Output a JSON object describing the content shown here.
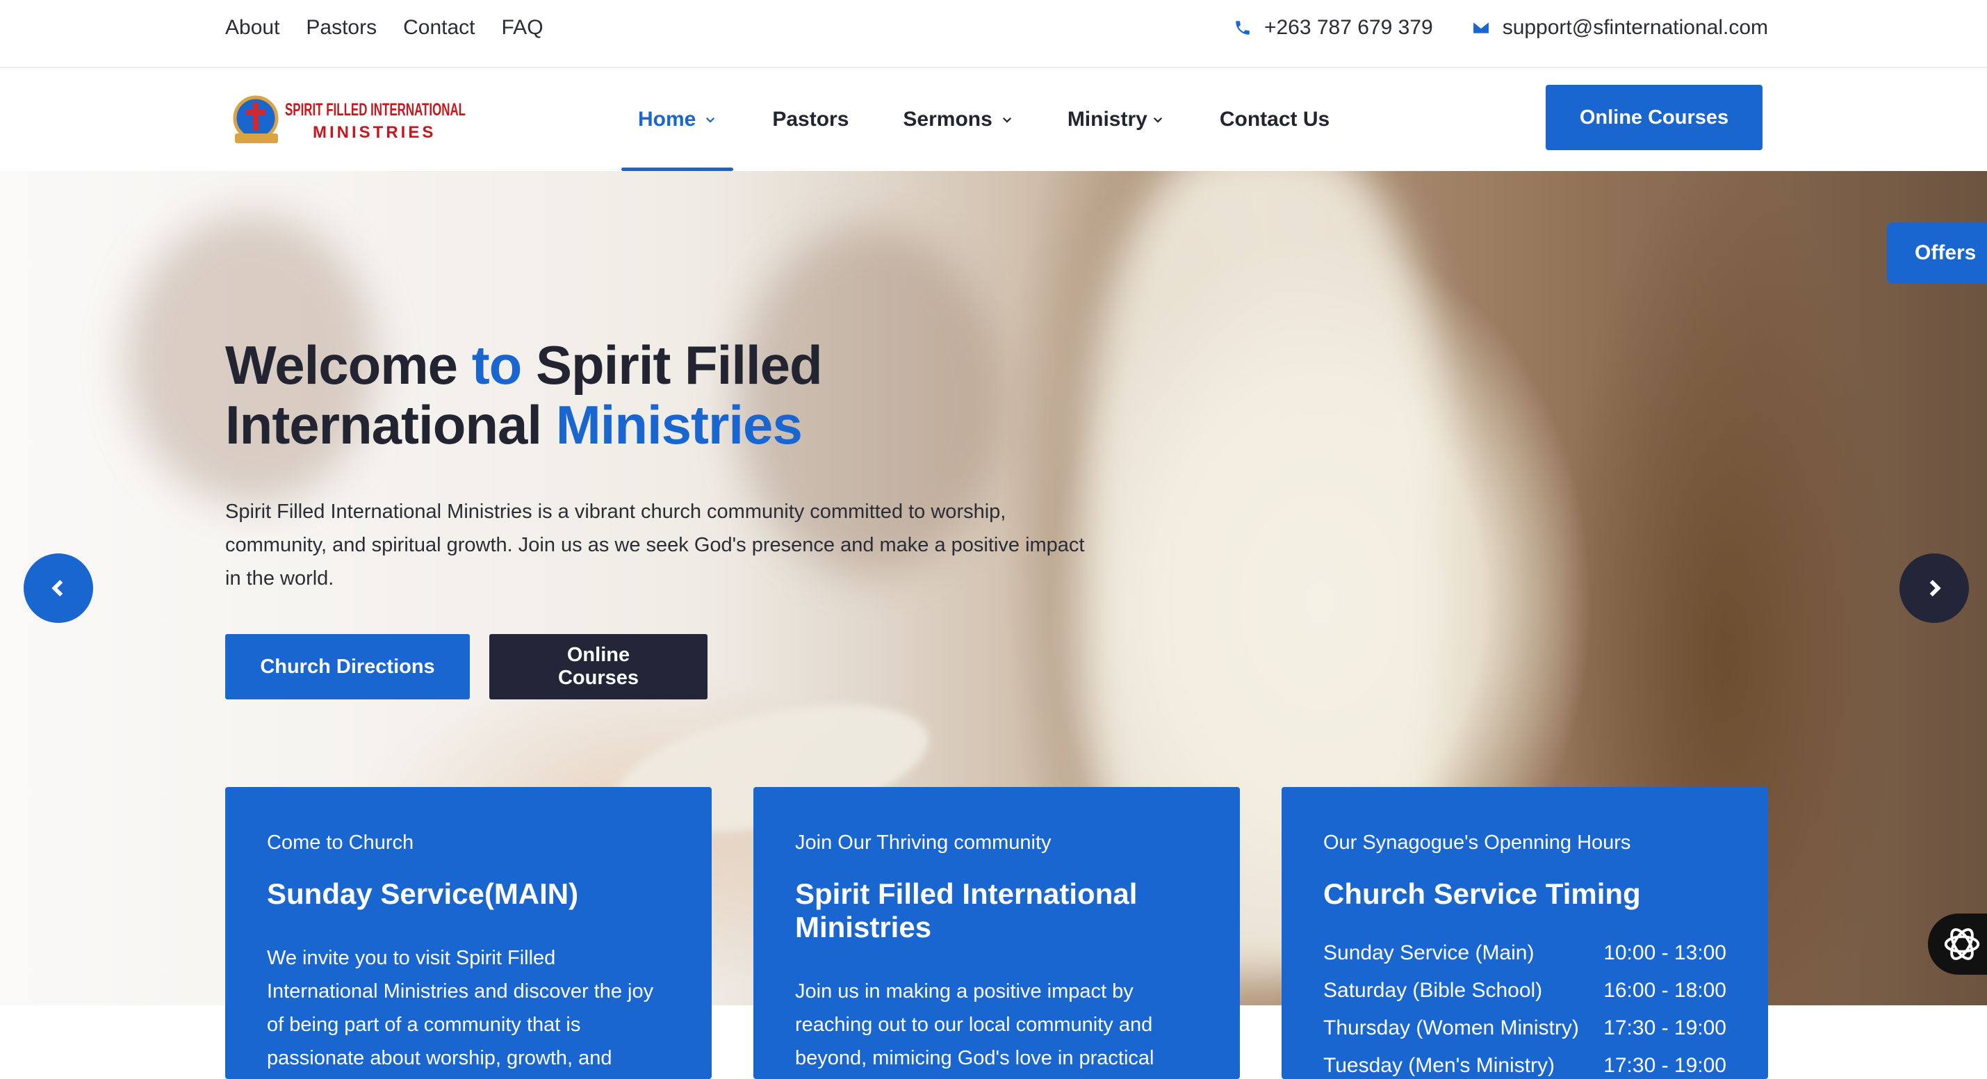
{
  "topbar": {
    "links": [
      "About",
      "Pastors",
      "Contact",
      "FAQ"
    ],
    "phone": "+263 787 679 379",
    "email": "support@sfinternational.com"
  },
  "navbar": {
    "logo": {
      "line1": "SPIRIT FILLED INTERNATIONAL",
      "line2": "MINISTRIES"
    },
    "items": [
      {
        "label": "Home",
        "dropdown": true,
        "active": true
      },
      {
        "label": "Pastors",
        "dropdown": false
      },
      {
        "label": "Sermons",
        "dropdown": true
      },
      {
        "label": "Ministry",
        "dropdown": true
      },
      {
        "label": "Contact Us",
        "dropdown": false
      }
    ],
    "cta": "Online Courses"
  },
  "hero": {
    "title_part1": "Welcome ",
    "title_accent1": "to",
    "title_part2": " Spirit Filled",
    "title_part3": "International ",
    "title_accent2": "Ministries",
    "description": "Spirit Filled International Ministries is a vibrant church community committed to worship, community, and spiritual growth. Join us as we seek God's presence and make a positive impact in the world.",
    "btn_directions": "Church Directions",
    "btn_courses": "Online Courses",
    "offers": "Offers"
  },
  "cards": [
    {
      "kicker": "Come to Church",
      "title": "Sunday Service(MAIN)",
      "body": "We invite you to visit Spirit Filled International Ministries and discover the joy of being part of a community that is passionate about worship, growth, and"
    },
    {
      "kicker": "Join Our Thriving community",
      "title": "Spirit Filled International Ministries",
      "body": "Join us in making a positive impact by reaching out to our local community and beyond, mimicing God's love in practical"
    },
    {
      "kicker": "Our Synagogue's Openning Hours",
      "title": "Church Service Timing",
      "schedule": [
        {
          "name": "Sunday Service (Main)",
          "time": "10:00 - 13:00"
        },
        {
          "name": "Saturday (Bible School)",
          "time": "16:00 - 18:00"
        },
        {
          "name": "Thursday (Women Ministry)",
          "time": "17:30 - 19:00"
        },
        {
          "name": "Tuesday (Men's Ministry)",
          "time": "17:30 - 19:00"
        }
      ]
    }
  ],
  "colors": {
    "accent": "#1a66d0",
    "dark": "#232638",
    "text": "#2a2c36"
  }
}
